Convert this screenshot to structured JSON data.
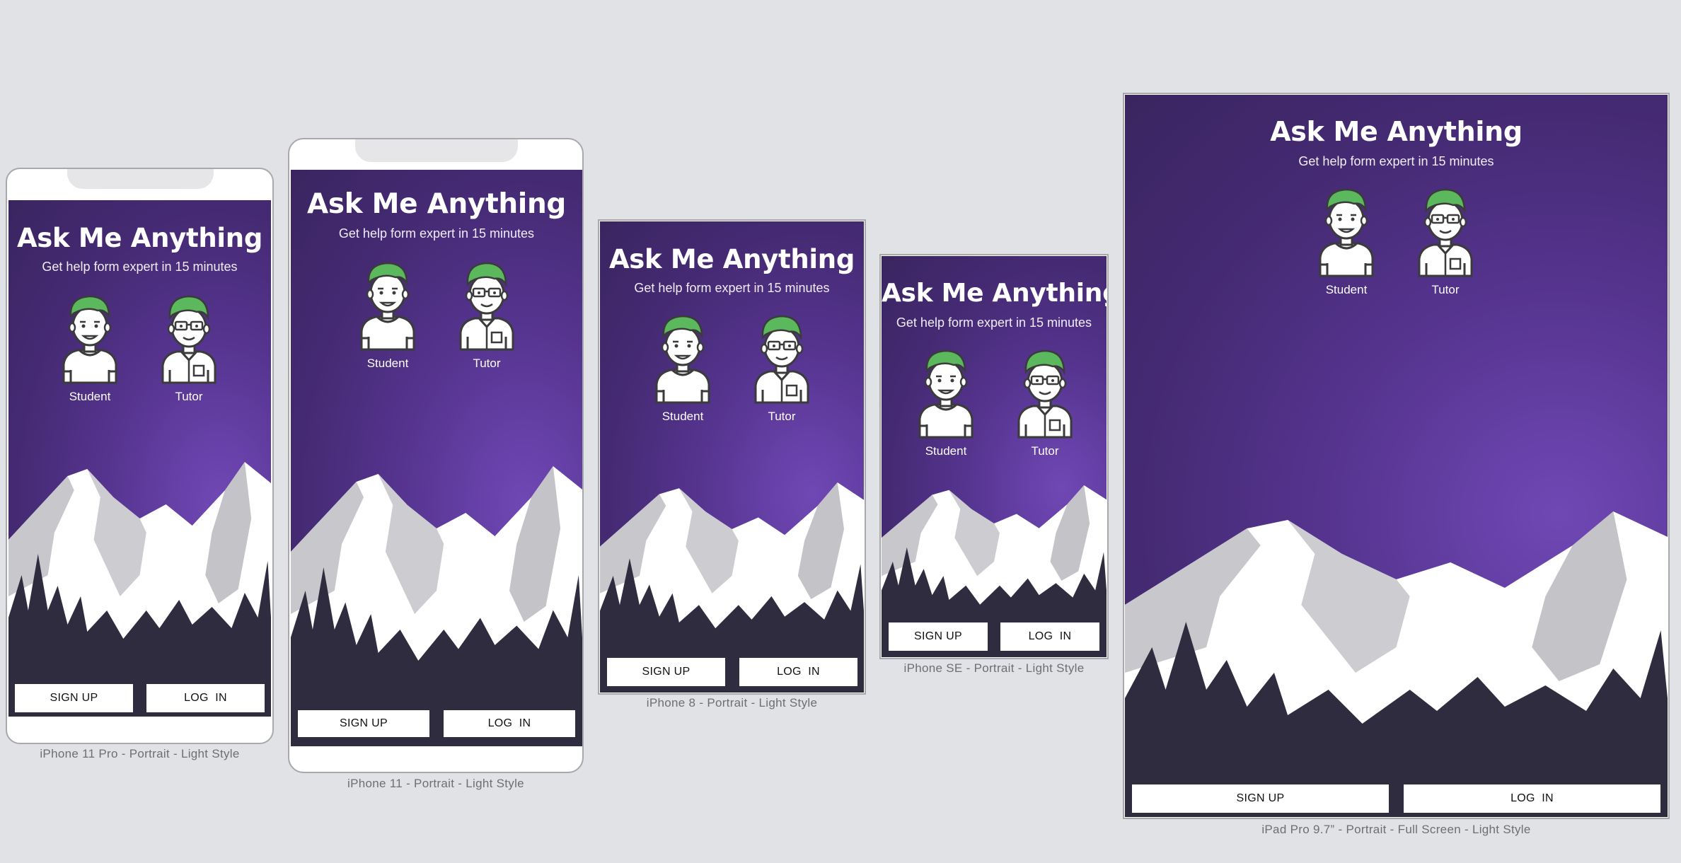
{
  "app": {
    "title": "Ask Me Anything",
    "subtitle": "Get help form expert in 15 minutes",
    "student_label": "Student",
    "tutor_label": "Tutor",
    "signup_label": "SIGN UP",
    "login_label": "LOG  IN"
  },
  "captions": {
    "iphone11pro": "iPhone 11 Pro - Portrait - Light Style",
    "iphone11": "iPhone 11 - Portrait - Light Style",
    "iphone8": "iPhone 8 - Portrait - Light Style",
    "iphonese": "iPhone SE - Portrait - Light Style",
    "ipad": "iPad Pro 9.7” - Portrait - Full Screen - Light Style"
  },
  "colors": {
    "canvas": "#e1e2e6",
    "gradient_top": "#3a2560",
    "gradient_glow": "#7048b5",
    "hair_green": "#5cb85c",
    "ground": "#302c3f",
    "button_bg": "#ffffff"
  },
  "icons": [
    "student-avatar",
    "tutor-avatar"
  ]
}
